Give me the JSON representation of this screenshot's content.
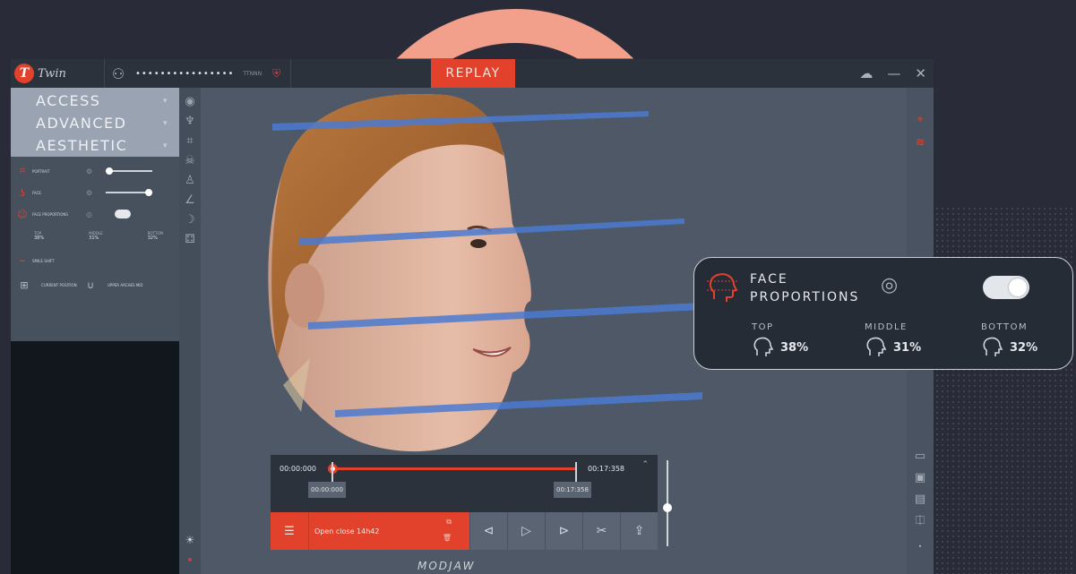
{
  "colors": {
    "accent": "#e2412b",
    "arc": "#f2a08c",
    "band": "#4b7ad0"
  },
  "app": {
    "logo_letter": "T",
    "logo_text": "Twin",
    "patient_id": "••••••••••••••••",
    "small_label": "TTNNN"
  },
  "header": {
    "replay_label": "REPLAY"
  },
  "window_controls": {
    "cloud": "☁",
    "minimize": "—",
    "close": "✕"
  },
  "sidebar": {
    "menus": [
      {
        "label": "ACCESS"
      },
      {
        "label": "ADVANCED"
      },
      {
        "label": "AESTHETIC"
      }
    ],
    "portrait_label": "PORTRAIT",
    "face_label": "FACE",
    "face_proportions_label": "FACE PROPORTIONS",
    "proportions": [
      {
        "label": "TOP",
        "value": "38%"
      },
      {
        "label": "MIDDLE",
        "value": "31%"
      },
      {
        "label": "BOTTOM",
        "value": "32%"
      }
    ],
    "slider_levels": {
      "portrait": 0.1,
      "face": 0.95
    },
    "smile_label": "SMILE SHIFT",
    "current_position_label": "CURRENT POSITION",
    "upper_arch_label": "UPPER ARCHES MID"
  },
  "player": {
    "start_time": "00:00:000",
    "end_time": "00:17:358",
    "chip_start": "00:00:000",
    "chip_end": "00:17:358",
    "clip_name": "Open close 14h42",
    "menu_icon": "☰",
    "buttons": [
      "⊲",
      "▷",
      "⊳",
      "✂",
      "⇪"
    ],
    "volume_level": 0.5
  },
  "brand": "MODJAW",
  "callout": {
    "title_line1": "FACE",
    "title_line2": "PROPORTIONS",
    "toggle_on": true,
    "columns": [
      {
        "label": "TOP",
        "value": "38%"
      },
      {
        "label": "MIDDLE",
        "value": "31%"
      },
      {
        "label": "BOTTOM",
        "value": "32%"
      }
    ]
  }
}
